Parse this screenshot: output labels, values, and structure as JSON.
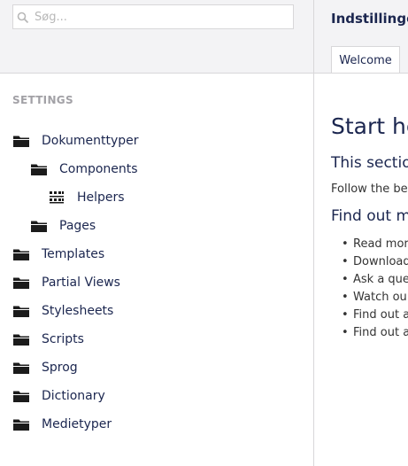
{
  "search": {
    "placeholder": "Søg..."
  },
  "tree": {
    "heading": "SETTINGS",
    "items": [
      {
        "label": "Dokumenttyper",
        "icon": "folder-icon"
      },
      {
        "label": "Components",
        "icon": "folder-icon"
      },
      {
        "label": "Helpers",
        "icon": "grid-icon"
      },
      {
        "label": "Pages",
        "icon": "folder-icon"
      },
      {
        "label": "Templates",
        "icon": "folder-icon"
      },
      {
        "label": "Partial Views",
        "icon": "folder-icon"
      },
      {
        "label": "Stylesheets",
        "icon": "folder-icon"
      },
      {
        "label": "Scripts",
        "icon": "folder-icon"
      },
      {
        "label": "Sprog",
        "icon": "folder-icon"
      },
      {
        "label": "Dictionary",
        "icon": "folder-icon"
      },
      {
        "label": "Medietyper",
        "icon": "folder-icon"
      }
    ]
  },
  "header": {
    "title": "Indstillinger"
  },
  "tabs": [
    {
      "label": "Welcome"
    }
  ],
  "content": {
    "title": "Start he",
    "subtitle": "This sectio",
    "text": "Follow the be",
    "subtitle2": "Find out m",
    "bullets": [
      "Read mor",
      "Download",
      "Ask a que",
      "Watch ou",
      "Find out a",
      "Find out a"
    ]
  },
  "colors": {
    "text": "#1b264f",
    "panel_bg": "#f3f3f5",
    "border": "#d8d7d9",
    "heading": "#a2a1a6"
  }
}
